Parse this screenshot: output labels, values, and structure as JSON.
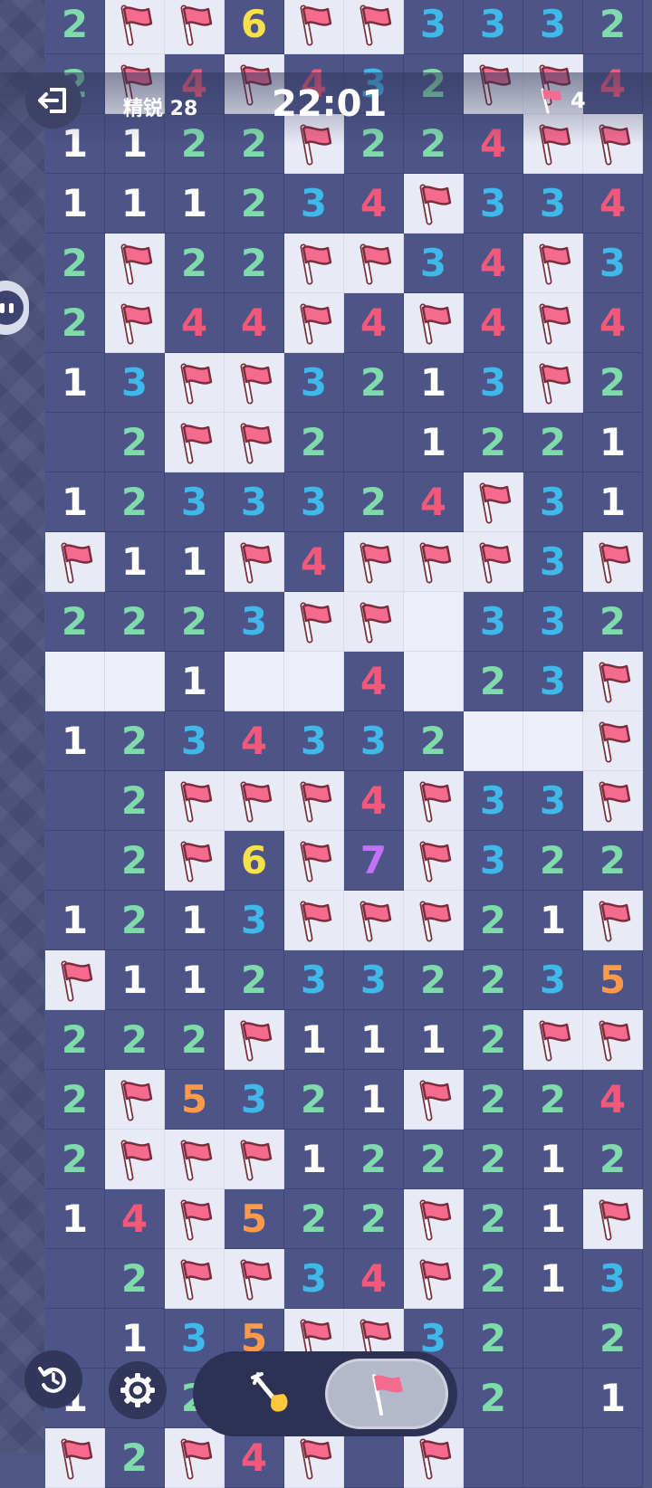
{
  "header": {
    "difficulty_label": "精锐 28",
    "timer": "22:01",
    "flags_remaining": "4"
  },
  "board": {
    "cols": 10,
    "rows": [
      [
        "2",
        "F",
        "F",
        "6",
        "F",
        "F",
        "3",
        "3",
        "3",
        "2"
      ],
      [
        "2",
        "F",
        "4",
        "F",
        "4",
        "3",
        "2",
        "F",
        "F",
        "4"
      ],
      [
        "1",
        "1",
        "2",
        "2",
        "F",
        "2",
        "2",
        "4",
        "F",
        "F"
      ],
      [
        "1",
        "1",
        "1",
        "2",
        "3",
        "4",
        "F",
        "3",
        "3",
        "4"
      ],
      [
        "2",
        "F",
        "2",
        "2",
        "F",
        "F",
        "3",
        "4",
        "F",
        "3"
      ],
      [
        "2",
        "F",
        "4",
        "4",
        "F",
        "4",
        "F",
        "4",
        "F",
        "4"
      ],
      [
        "1",
        "3",
        "F",
        "F",
        "3",
        "2",
        "1",
        "3",
        "F",
        "2"
      ],
      [
        "",
        "2",
        "F",
        "F",
        "2",
        "",
        "1",
        "2",
        "2",
        "1"
      ],
      [
        "1",
        "2",
        "3",
        "3",
        "3",
        "2",
        "4",
        "F",
        "3",
        "1"
      ],
      [
        "F",
        "1",
        "1",
        "F",
        "4",
        "F",
        "F",
        "F",
        "3",
        "F"
      ],
      [
        "2",
        "2",
        "2",
        "3",
        "F",
        "F",
        "U",
        "3",
        "3",
        "2"
      ],
      [
        "U",
        "U",
        "1",
        "U",
        "U",
        "4",
        "U",
        "2",
        "3",
        "F"
      ],
      [
        "1",
        "2",
        "3",
        "4",
        "3",
        "3",
        "2",
        "U",
        "U",
        "F"
      ],
      [
        "",
        "2",
        "F",
        "F",
        "F",
        "4",
        "F",
        "3",
        "3",
        "F"
      ],
      [
        "",
        "2",
        "F",
        "6",
        "F",
        "7",
        "F",
        "3",
        "2",
        "2"
      ],
      [
        "1",
        "2",
        "1",
        "3",
        "F",
        "F",
        "F",
        "2",
        "1",
        "F"
      ],
      [
        "F",
        "1",
        "1",
        "2",
        "3",
        "3",
        "2",
        "2",
        "3",
        "5"
      ],
      [
        "2",
        "2",
        "2",
        "F",
        "1",
        "1",
        "1",
        "2",
        "F",
        "F"
      ],
      [
        "2",
        "F",
        "5",
        "3",
        "2",
        "1",
        "F",
        "2",
        "2",
        "4"
      ],
      [
        "2",
        "F",
        "F",
        "F",
        "1",
        "2",
        "2",
        "2",
        "1",
        "2"
      ],
      [
        "1",
        "4",
        "F",
        "5",
        "2",
        "2",
        "F",
        "2",
        "1",
        "F"
      ],
      [
        "",
        "2",
        "F",
        "F",
        "3",
        "4",
        "F",
        "2",
        "1",
        "3"
      ],
      [
        "",
        "1",
        "3",
        "5",
        "F",
        "F",
        "3",
        "2",
        "",
        "2"
      ],
      [
        "1",
        "2",
        "2",
        "",
        "",
        "",
        "",
        "2",
        "",
        "1"
      ],
      [
        "F",
        "2",
        "F",
        "4",
        "F",
        "",
        "F",
        "",
        "",
        ""
      ]
    ]
  },
  "colors": {
    "revealed": "#4c5488",
    "unrevealed": "#eceef8",
    "flag": "#f56b8f",
    "n1": "#ffffff",
    "n2": "#7fdcaa",
    "n3": "#3fb8ea",
    "n4": "#f2587a",
    "n5": "#ff9a4a",
    "n6": "#f8e04a",
    "n7": "#c272f4"
  },
  "icons": {
    "exit": "exit-icon",
    "flag_counter": "flag-icon",
    "chat": "chat-bubble-icon",
    "restart": "restart-icon",
    "settings": "gear-icon",
    "dig": "shovel-icon",
    "flag_mode": "flag-icon"
  },
  "controls": {
    "active_mode": "flag"
  }
}
